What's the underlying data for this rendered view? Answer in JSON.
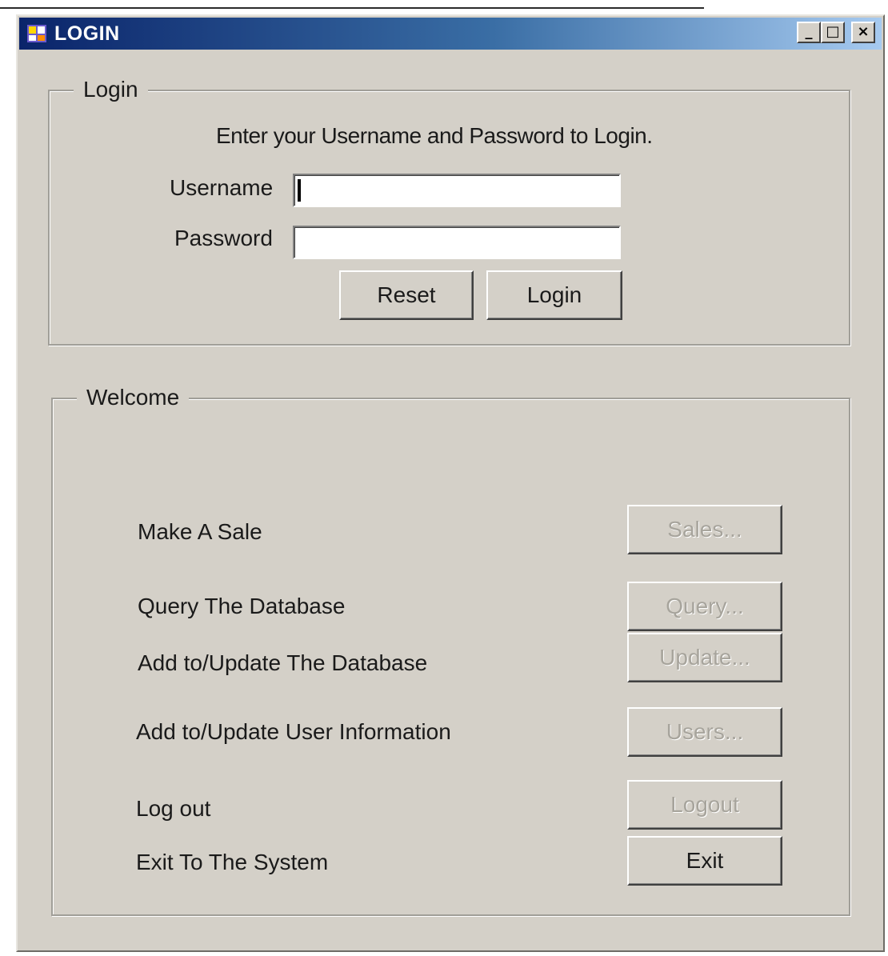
{
  "window": {
    "title": "LOGIN",
    "controls": {
      "minimize": "_",
      "maximize": "□",
      "close": "×"
    }
  },
  "login_group": {
    "legend": "Login",
    "instructions": "Enter your Username and Password to Login.",
    "username_label": "Username",
    "username_value": "",
    "password_label": "Password",
    "password_value": "",
    "reset_label": "Reset",
    "login_label": "Login"
  },
  "welcome_group": {
    "legend": "Welcome",
    "rows": [
      {
        "label": "Make A Sale",
        "button": "Sales...",
        "enabled": false
      },
      {
        "label": "Query The Database",
        "button": "Query...",
        "enabled": false
      },
      {
        "label": "Add to/Update The Database",
        "button": "Update...",
        "enabled": false
      },
      {
        "label": "Add to/Update User Information",
        "button": "Users...",
        "enabled": false
      },
      {
        "label": "Log out",
        "button": "Logout",
        "enabled": false
      },
      {
        "label": "Exit To The System",
        "button": "Exit",
        "enabled": true
      }
    ]
  },
  "colors": {
    "titlebar_start": "#0a246a",
    "titlebar_end": "#a6caf0",
    "window_face": "#d4d0c8",
    "disabled_text": "#a7a49c"
  },
  "icons": {
    "app_icon": "login-app-icon"
  }
}
